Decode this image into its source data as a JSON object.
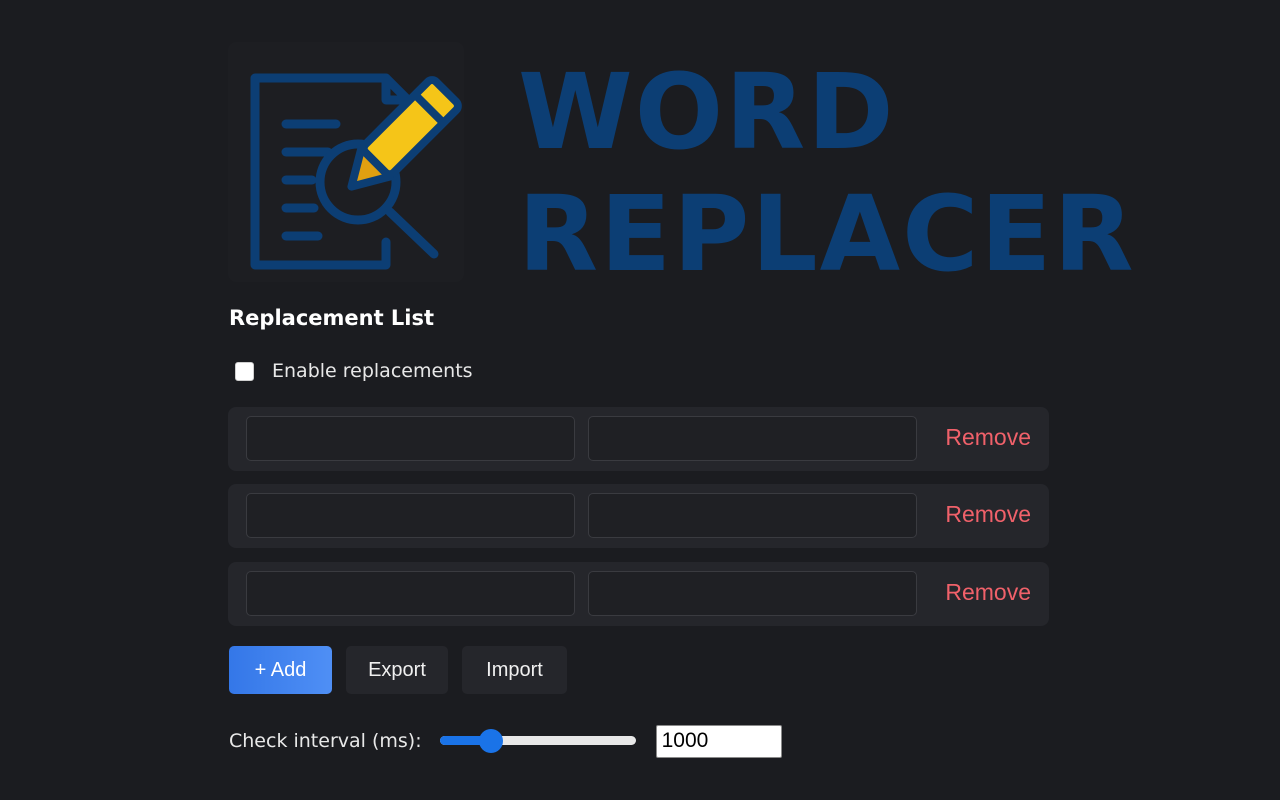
{
  "logo": {
    "line1": "WORD",
    "line2": "REPLACER",
    "colors": {
      "primary": "#0c3e74",
      "pencil": "#f5c518"
    }
  },
  "section_title": "Replacement List",
  "enable": {
    "label": "Enable replacements",
    "checked": false
  },
  "rules": [
    {
      "from": "",
      "to": "",
      "remove_label": "Remove"
    },
    {
      "from": "",
      "to": "",
      "remove_label": "Remove"
    },
    {
      "from": "",
      "to": "",
      "remove_label": "Remove"
    }
  ],
  "buttons": {
    "add": "+ Add",
    "export": "Export",
    "import": "Import"
  },
  "interval": {
    "label": "Check interval (ms):",
    "value": "1000",
    "slider_fraction": 0.23
  },
  "colors": {
    "accent": "#3477e8",
    "danger": "#f0616a",
    "background": "#1b1c20",
    "row": "#25262b"
  }
}
